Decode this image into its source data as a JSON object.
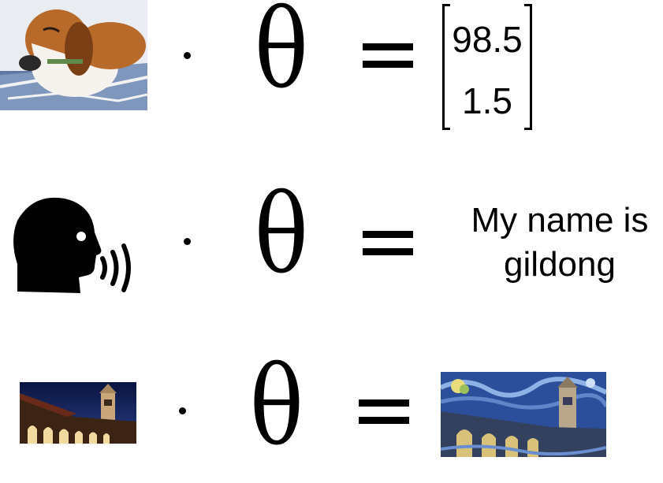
{
  "rows": [
    {
      "input": {
        "kind": "photo",
        "icon": "beagle-dog-photo"
      },
      "operator": "·",
      "parameter": "θ",
      "equals": "=",
      "output": {
        "kind": "vector",
        "values": [
          "98.5",
          "1.5"
        ]
      }
    },
    {
      "input": {
        "kind": "icon",
        "icon": "speaking-head-icon"
      },
      "operator": "·",
      "parameter": "θ",
      "equals": "=",
      "output": {
        "kind": "text",
        "lines": [
          "My name is",
          "gildong"
        ]
      }
    },
    {
      "input": {
        "kind": "photo",
        "icon": "stanford-tower-night-photo"
      },
      "operator": "·",
      "parameter": "θ",
      "equals": "=",
      "output": {
        "kind": "photo",
        "icon": "starry-night-style-tower-painting"
      }
    }
  ],
  "colors": {
    "ink": "#000000",
    "background": "#ffffff",
    "dog_fur": "#b86a2a",
    "night_sky": "#0e1a4a",
    "painting_blue": "#2b4f9a"
  }
}
